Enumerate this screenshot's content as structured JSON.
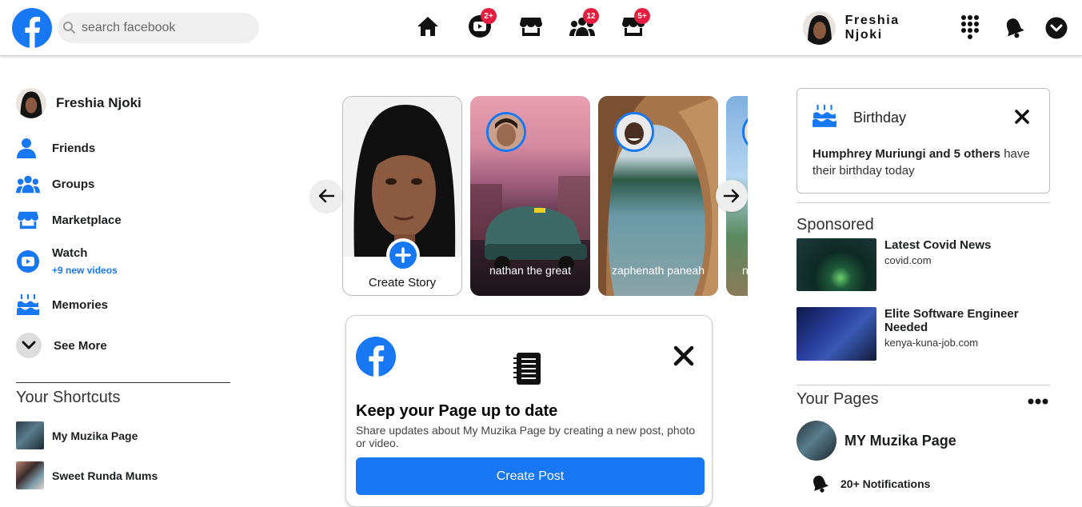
{
  "header": {
    "search_placeholder": "search facebook",
    "nav": [
      {
        "name": "home",
        "badge": ""
      },
      {
        "name": "watch",
        "badge": "2+"
      },
      {
        "name": "marketplace",
        "badge": ""
      },
      {
        "name": "groups",
        "badge": "12"
      },
      {
        "name": "gaming",
        "badge": "5+"
      }
    ],
    "profile_name": "Freshia Njoki"
  },
  "sidebar": {
    "profile_name": "Freshia Njoki",
    "items": [
      {
        "label": "Friends",
        "icon": "friends-icon"
      },
      {
        "label": "Groups",
        "icon": "groups-icon"
      },
      {
        "label": "Marketplace",
        "icon": "marketplace-icon"
      },
      {
        "label": "Watch",
        "icon": "watch-icon",
        "sub": "+9 new videos"
      },
      {
        "label": "Memories",
        "icon": "memories-icon"
      }
    ],
    "see_more": "See More",
    "shortcuts_title": "Your Shortcuts",
    "shortcuts": [
      {
        "label": "My Muzika Page"
      },
      {
        "label": "Sweet Runda Mums"
      }
    ]
  },
  "stories": {
    "create_label": "Create Story",
    "items": [
      {
        "name": "nathan the great"
      },
      {
        "name": "zaphenath paneah"
      }
    ],
    "partial_name": "n"
  },
  "page_card": {
    "title": "Keep your Page up to date",
    "description": "Share updates about My Muzika Page by creating a new post, photo or video.",
    "button": "Create Post"
  },
  "right": {
    "birthday": {
      "title": "Birthday",
      "names": "Humphrey Muriungi and 5 others",
      "rest": " have their birthday today"
    },
    "sponsored_title": "Sponsored",
    "ads": [
      {
        "headline": "Latest Covid News",
        "url": "covid.com"
      },
      {
        "headline": "Elite Software Engineer Needed",
        "url": "kenya-kuna-job.com"
      }
    ],
    "pages_title": "Your Pages",
    "page_name": "MY Muzika Page",
    "notifications": "20+ Notifications"
  },
  "colors": {
    "brand": "#1877f2",
    "badge": "#e41e3f"
  }
}
